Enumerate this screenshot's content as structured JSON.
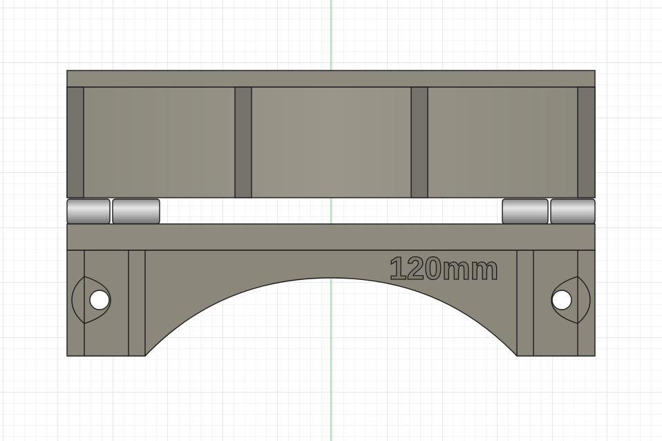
{
  "viewport": {
    "background": "#ffffff",
    "grid_minor_color": "#e4e6e8",
    "grid_major_color": "#c9cdd1",
    "axis_color": "#7ccd7c"
  },
  "model": {
    "part_color": "#8e8a7c",
    "part_light": "#a39f91",
    "part_dark": "#6f6b60",
    "edge_color": "#1a1a1a",
    "hinge_color": "#b9b9b9",
    "engraving_text": "120mm",
    "mounting_hole_icon": "circle-hole",
    "hinge_icon": "cylinder-hinge"
  }
}
